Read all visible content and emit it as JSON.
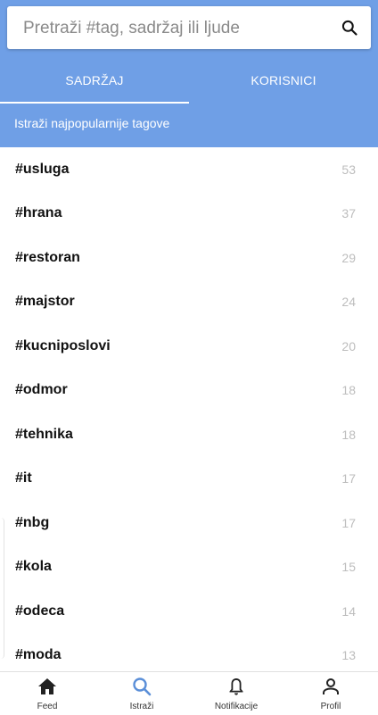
{
  "search": {
    "placeholder": "Pretraži #tag, sadržaj ili ljude",
    "icon": "search-icon"
  },
  "tabs": [
    {
      "label": "SADRŽAJ",
      "active": true
    },
    {
      "label": "KORISNICI",
      "active": false
    }
  ],
  "section_title": "Istraži najpopularnije tagove",
  "tags": [
    {
      "name": "#usluga",
      "count": "53"
    },
    {
      "name": "#hrana",
      "count": "37"
    },
    {
      "name": "#restoran",
      "count": "29"
    },
    {
      "name": "#majstor",
      "count": "24"
    },
    {
      "name": "#kucniposlovi",
      "count": "20"
    },
    {
      "name": "#odmor",
      "count": "18"
    },
    {
      "name": "#tehnika",
      "count": "18"
    },
    {
      "name": "#it",
      "count": "17"
    },
    {
      "name": "#nbg",
      "count": "17"
    },
    {
      "name": "#kola",
      "count": "15"
    },
    {
      "name": "#odeca",
      "count": "14"
    },
    {
      "name": "#moda",
      "count": "13"
    }
  ],
  "bottom_nav": [
    {
      "label": "Feed",
      "icon": "home-icon"
    },
    {
      "label": "Istraži",
      "icon": "search-icon",
      "active": true
    },
    {
      "label": "Notifikacije",
      "icon": "bell-icon"
    },
    {
      "label": "Profil",
      "icon": "person-icon"
    }
  ],
  "colors": {
    "primary": "#6f9fe6",
    "active_icon": "#5b8fd8",
    "count": "#bdbdbd"
  }
}
